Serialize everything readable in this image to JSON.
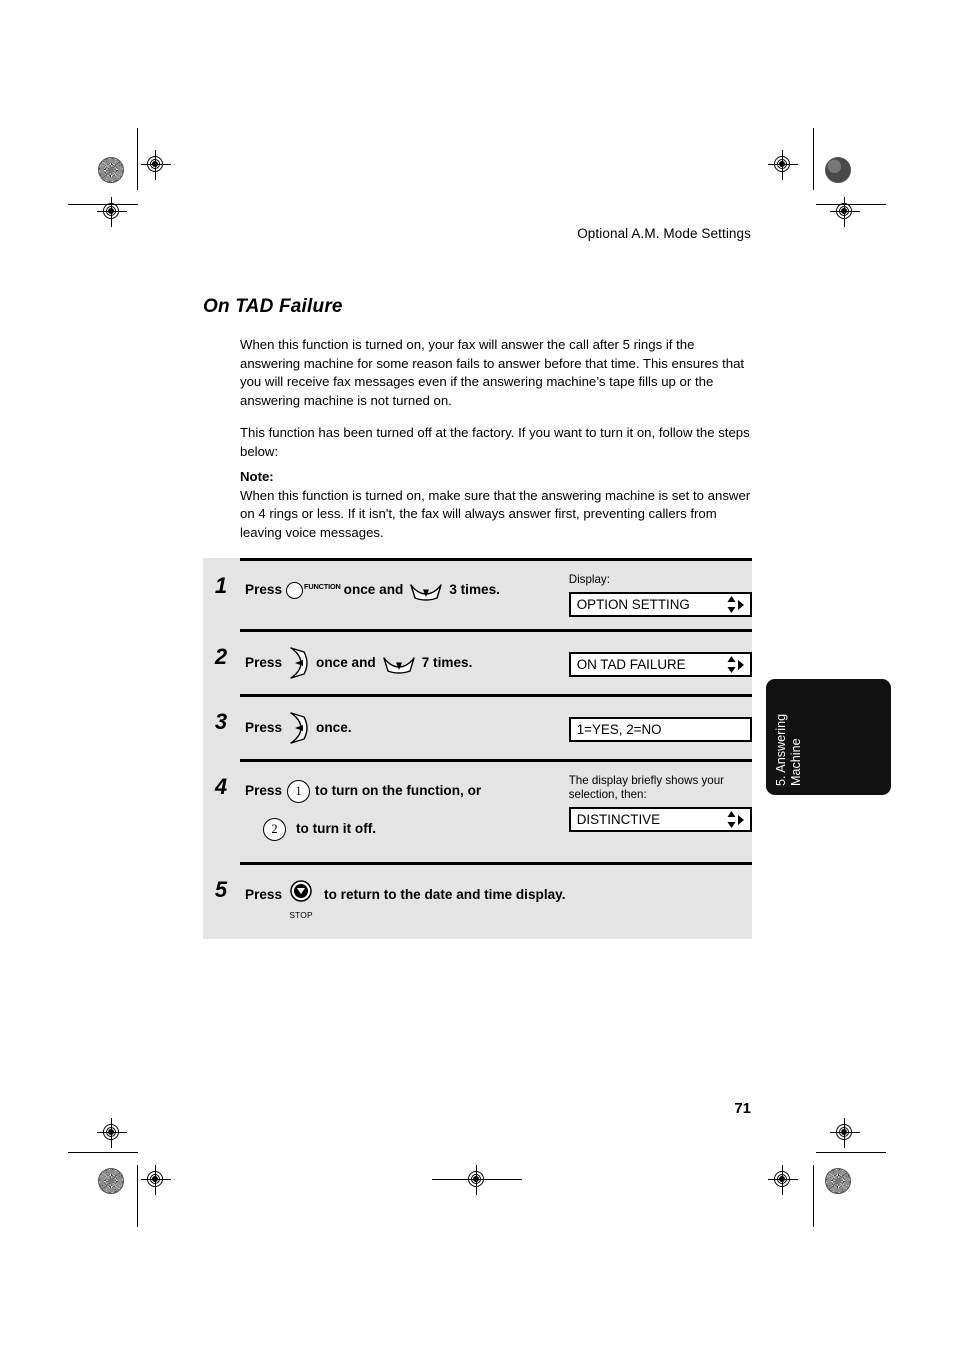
{
  "page": {
    "running_head": "Optional A.M. Mode Settings",
    "section_title": "On TAD Failure",
    "folio": "71"
  },
  "body": {
    "paragraph_1": "When this function is turned on, your fax will answer the call after 5 rings if the answering machine for some reason fails to answer before that time. This ensures that you will receive fax messages even if the answering machine’s tape fills up or the answering machine is not turned on.",
    "paragraph_2": "This function has been turned off at the factory. If you want to turn it on, follow the steps below:",
    "note_label": "Note:",
    "note_text": "When this function is turned on, make sure that the answering machine is set to answer on 4 rings or less. If it isn't, the fax will always answer first, preventing callers from leaving voice messages."
  },
  "steps": [
    {
      "number": "1",
      "text_before": "Press",
      "key_1_label": "FUNCTION",
      "text_middle": "once and",
      "text_after": "3 times.",
      "display_caption": "Display:",
      "display_text": "OPTION SETTING"
    },
    {
      "number": "2",
      "text_before": "Press",
      "text_middle": "once and",
      "text_after": "7 times.",
      "display_text": "ON TAD FAILURE"
    },
    {
      "number": "3",
      "text_before": "Press",
      "text_after": "once.",
      "display_text": "1=YES, 2=NO"
    },
    {
      "number": "4",
      "text_before": "Press",
      "key_digit_1": "1",
      "text_after": "to turn on the function, or",
      "key_digit_2": "2",
      "text_line2": "to turn it off.",
      "display_caption": "The display briefly shows your selection, then:",
      "display_text": "DISTINCTIVE"
    },
    {
      "number": "5",
      "text_before": "Press",
      "key_label": "STOP",
      "text_after": "to return to the date and time display."
    }
  ],
  "side_tab": {
    "line_1": "5. Answering",
    "line_2": "Machine"
  },
  "colors": {
    "panel_background": "#e4e4e4",
    "tab_background": "#111111",
    "ink": "#000000",
    "paper": "#ffffff"
  }
}
